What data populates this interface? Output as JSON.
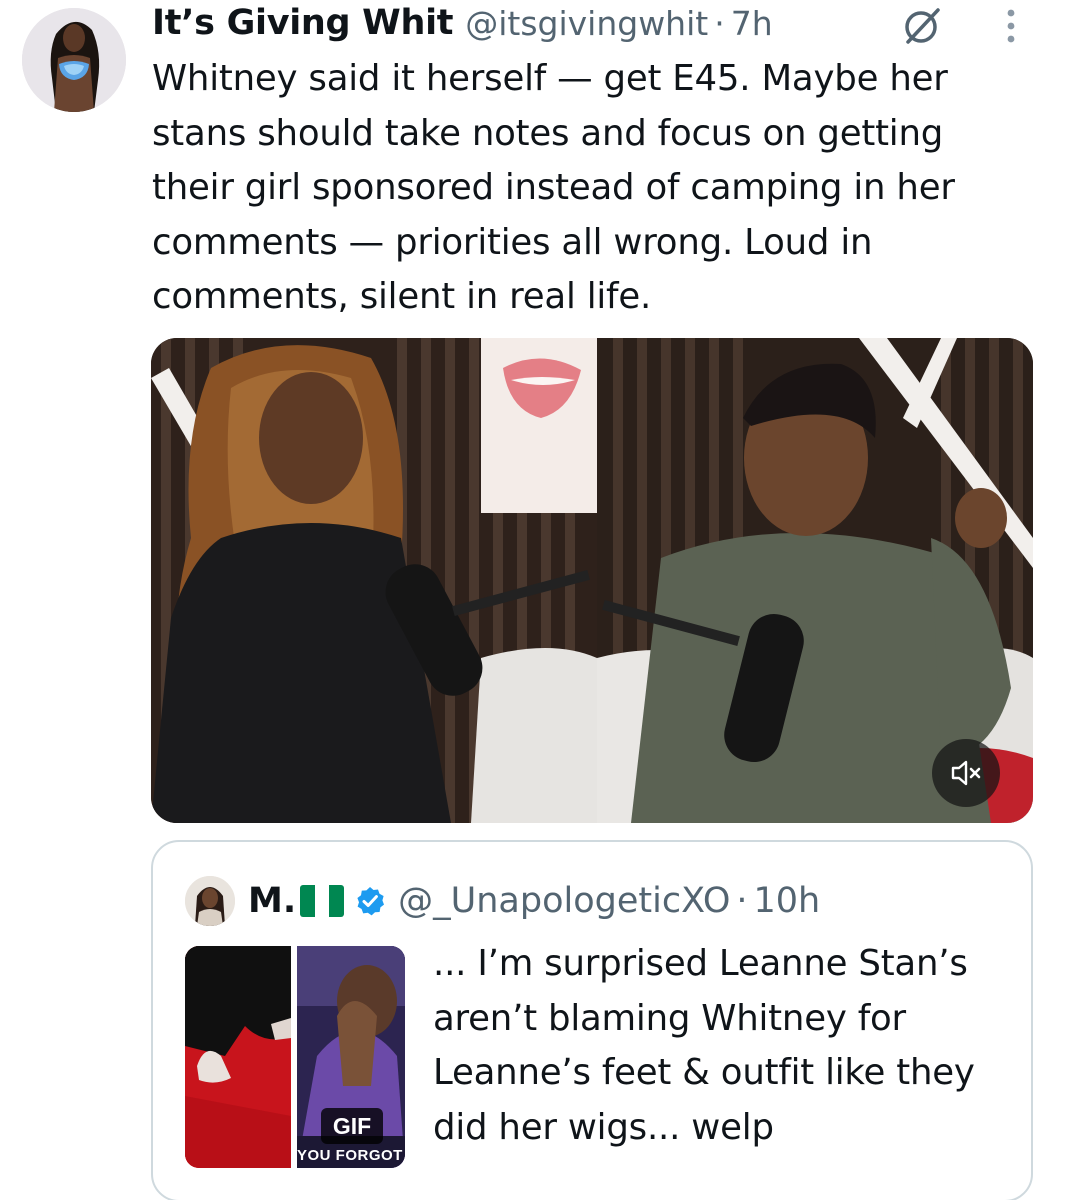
{
  "tweet": {
    "display_name": "It’s Giving Whit",
    "handle": "@itsgivingwhit",
    "separator": "·",
    "time": "7h",
    "text": "Whitney said it herself — get E45. Maybe her stans should take notes and focus on getting their girl sponsored instead of camping in her comments — priorities all wrong. Loud in comments, silent in real life."
  },
  "quoted_tweet": {
    "display_name": "M.",
    "flag_colors": [
      "#008751",
      "#ffffff",
      "#008751"
    ],
    "handle": "@_UnapologeticXO",
    "separator": "·",
    "time": "10h",
    "text": "... I’m surprised Leanne Stan’s aren’t blaming Whitney for Leanne’s feet & outfit like they did her wigs... welp",
    "gif_badge": "GIF",
    "gif_caption": "YOU FORGOT I"
  },
  "icons": {
    "grok": "grok-icon",
    "more": "more-vertical-icon",
    "mute": "volume-muted-icon",
    "verified": "verified-badge-icon"
  },
  "colors": {
    "text_primary": "#0f1419",
    "text_secondary": "#536471",
    "border": "#cfd9de",
    "verified_blue": "#1d9bf0"
  }
}
